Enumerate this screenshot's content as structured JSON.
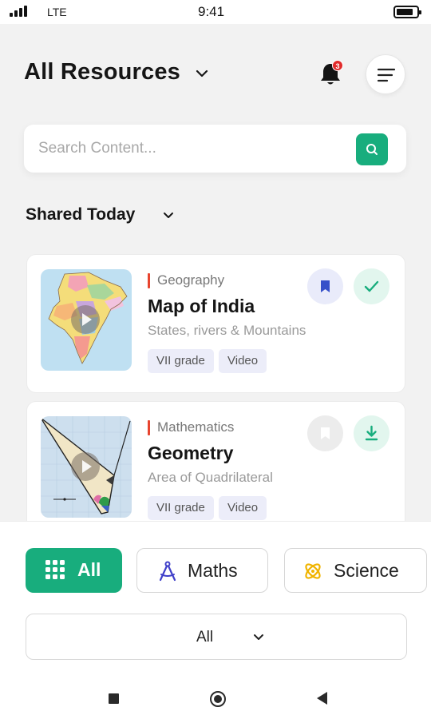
{
  "status_bar": {
    "network": "LTE",
    "time": "9:41"
  },
  "header": {
    "title": "All Resources",
    "notification_count": "3"
  },
  "search": {
    "placeholder": "Search Content..."
  },
  "section": {
    "title": "Shared Today"
  },
  "cards": [
    {
      "subject": "Geography",
      "title": "Map of India",
      "subtitle": "States, rivers & Mountains",
      "tags": [
        "VII grade",
        "Video"
      ],
      "bookmarked": true,
      "status_icon": "check-icon"
    },
    {
      "subject": "Mathematics",
      "title": "Geometry",
      "subtitle": "Area of Quadrilateral",
      "tags": [
        "VII grade",
        "Video"
      ],
      "bookmarked": false,
      "status_icon": "download-icon"
    }
  ],
  "filters": {
    "pills": [
      {
        "label": "All",
        "icon": "grid-icon",
        "selected": true
      },
      {
        "label": "Maths",
        "icon": "compass-icon",
        "selected": false
      },
      {
        "label": "Science",
        "icon": "atom-icon",
        "selected": false
      }
    ],
    "dropdown": {
      "value": "All"
    }
  },
  "colors": {
    "accent": "#18ad7d",
    "subject_marker": "#e8452f",
    "bookmark_active": "#3550c9",
    "badge": "#e12b2b"
  }
}
